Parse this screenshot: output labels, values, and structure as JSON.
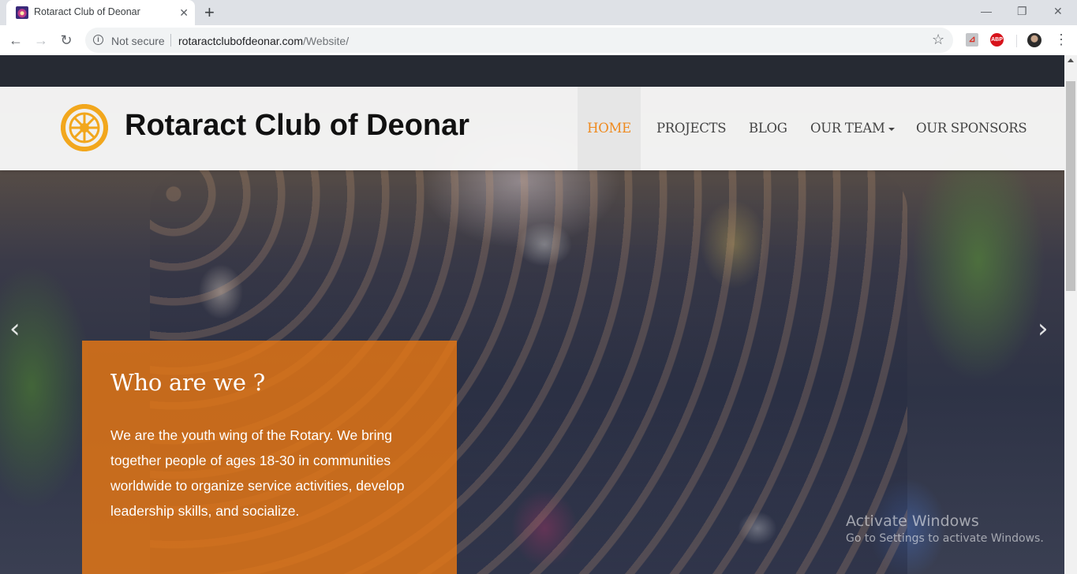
{
  "browser": {
    "tab_title": "Rotaract Club of Deonar",
    "tab_close": "✕",
    "new_tab": "+",
    "window_controls": {
      "minimize": "—",
      "restore": "❐",
      "close": "✕"
    },
    "back_icon": "←",
    "forward_icon": "→",
    "reload_icon": "↻",
    "security_label": "Not secure",
    "url_host": "rotaractclubofdeonar.com",
    "url_path": "/Website/",
    "bookmark_icon": "☆",
    "extension_pdf_icon": "pdf-icon",
    "extension_abp_label": "ABP",
    "menu_icon": "⋮"
  },
  "site": {
    "title": "Rotaract Club of Deonar",
    "logo": "rotary-wheel-logo",
    "nav": [
      {
        "label": "HOME",
        "active": true
      },
      {
        "label": "PROJECTS",
        "active": false
      },
      {
        "label": "BLOG",
        "active": false
      },
      {
        "label": "OUR TEAM",
        "active": false,
        "dropdown": true
      },
      {
        "label": "OUR SPONSORS",
        "active": false
      }
    ],
    "accent_color": "#ef8a1e"
  },
  "carousel": {
    "prev_icon": "‹",
    "next_icon": "›",
    "callout": {
      "heading": "Who are we ?",
      "text": "We are the youth wing of the Rotary. We bring together people of ages 18-30 in communities worldwide to organize service activities, develop leadership skills, and socialize.",
      "background_color": "#e87714"
    }
  },
  "watermark": {
    "title": "Activate Windows",
    "subtitle": "Go to Settings to activate Windows."
  }
}
